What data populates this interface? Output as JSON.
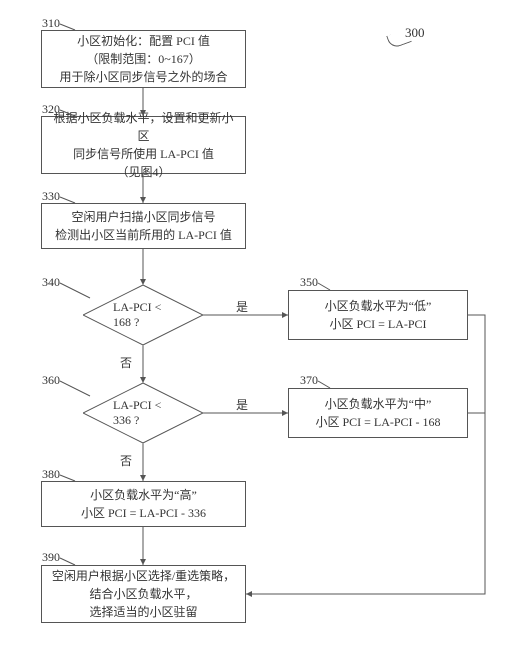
{
  "chart_data": {
    "type": "flowchart",
    "title": "",
    "ref_label": "300",
    "nodes": [
      {
        "id": "310",
        "num_label": "310",
        "shape": "rect",
        "lines": [
          "小区初始化：配置 PCI 值",
          "（限制范围：0~167）",
          "用于除小区同步信号之外的场合"
        ]
      },
      {
        "id": "320",
        "num_label": "320",
        "shape": "rect",
        "lines": [
          "根据小区负载水平，设置和更新小区",
          "同步信号所使用 LA-PCI 值",
          "（见图4）"
        ]
      },
      {
        "id": "330",
        "num_label": "330",
        "shape": "rect",
        "lines": [
          "空闲用户扫描小区同步信号",
          "检测出小区当前所用的 LA-PCI 值"
        ]
      },
      {
        "id": "340",
        "num_label": "340",
        "shape": "diamond",
        "lines": [
          "LA-PCI < 168 ?"
        ]
      },
      {
        "id": "350",
        "num_label": "350",
        "shape": "rect",
        "lines": [
          "小区负载水平为“低”",
          "小区 PCI = LA-PCI"
        ]
      },
      {
        "id": "360",
        "num_label": "360",
        "shape": "diamond",
        "lines": [
          "LA-PCI < 336 ?"
        ]
      },
      {
        "id": "370",
        "num_label": "370",
        "shape": "rect",
        "lines": [
          "小区负载水平为“中”",
          "小区 PCI = LA-PCI - 168"
        ]
      },
      {
        "id": "380",
        "num_label": "380",
        "shape": "rect",
        "lines": [
          "小区负载水平为“高”",
          "小区 PCI = LA-PCI - 336"
        ]
      },
      {
        "id": "390",
        "num_label": "390",
        "shape": "rect",
        "lines": [
          "空闲用户根据小区选择/重选策略，",
          "结合小区负载水平，",
          "选择适当的小区驻留"
        ]
      }
    ],
    "edges": [
      {
        "from": "310",
        "to": "320",
        "label": ""
      },
      {
        "from": "320",
        "to": "330",
        "label": ""
      },
      {
        "from": "330",
        "to": "340",
        "label": ""
      },
      {
        "from": "340",
        "to": "350",
        "label": "是"
      },
      {
        "from": "340",
        "to": "360",
        "label": "否"
      },
      {
        "from": "360",
        "to": "370",
        "label": "是"
      },
      {
        "from": "360",
        "to": "380",
        "label": "否"
      },
      {
        "from": "350",
        "to": "390",
        "label": ""
      },
      {
        "from": "370",
        "to": "390",
        "label": ""
      },
      {
        "from": "380",
        "to": "390",
        "label": ""
      }
    ]
  }
}
